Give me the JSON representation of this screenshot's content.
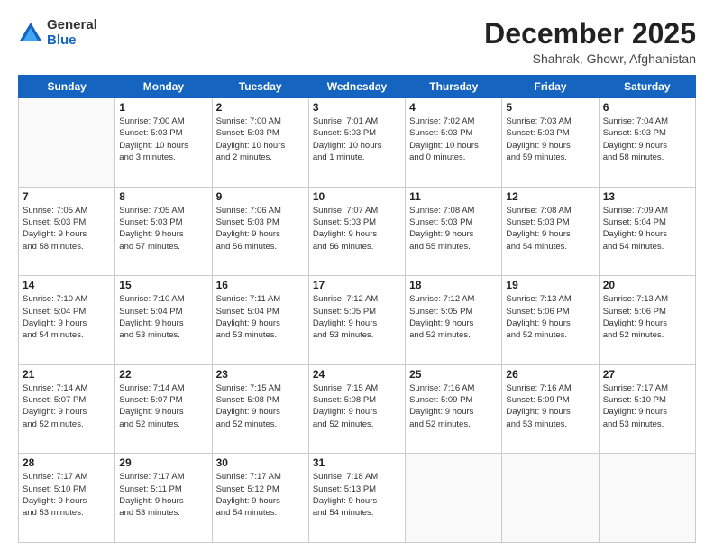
{
  "logo": {
    "general": "General",
    "blue": "Blue"
  },
  "header": {
    "month_year": "December 2025",
    "location": "Shahrak, Ghowr, Afghanistan"
  },
  "weekdays": [
    "Sunday",
    "Monday",
    "Tuesday",
    "Wednesday",
    "Thursday",
    "Friday",
    "Saturday"
  ],
  "weeks": [
    [
      {
        "day": "",
        "info": ""
      },
      {
        "day": "1",
        "info": "Sunrise: 7:00 AM\nSunset: 5:03 PM\nDaylight: 10 hours\nand 3 minutes."
      },
      {
        "day": "2",
        "info": "Sunrise: 7:00 AM\nSunset: 5:03 PM\nDaylight: 10 hours\nand 2 minutes."
      },
      {
        "day": "3",
        "info": "Sunrise: 7:01 AM\nSunset: 5:03 PM\nDaylight: 10 hours\nand 1 minute."
      },
      {
        "day": "4",
        "info": "Sunrise: 7:02 AM\nSunset: 5:03 PM\nDaylight: 10 hours\nand 0 minutes."
      },
      {
        "day": "5",
        "info": "Sunrise: 7:03 AM\nSunset: 5:03 PM\nDaylight: 9 hours\nand 59 minutes."
      },
      {
        "day": "6",
        "info": "Sunrise: 7:04 AM\nSunset: 5:03 PM\nDaylight: 9 hours\nand 58 minutes."
      }
    ],
    [
      {
        "day": "7",
        "info": "Sunrise: 7:05 AM\nSunset: 5:03 PM\nDaylight: 9 hours\nand 58 minutes."
      },
      {
        "day": "8",
        "info": "Sunrise: 7:05 AM\nSunset: 5:03 PM\nDaylight: 9 hours\nand 57 minutes."
      },
      {
        "day": "9",
        "info": "Sunrise: 7:06 AM\nSunset: 5:03 PM\nDaylight: 9 hours\nand 56 minutes."
      },
      {
        "day": "10",
        "info": "Sunrise: 7:07 AM\nSunset: 5:03 PM\nDaylight: 9 hours\nand 56 minutes."
      },
      {
        "day": "11",
        "info": "Sunrise: 7:08 AM\nSunset: 5:03 PM\nDaylight: 9 hours\nand 55 minutes."
      },
      {
        "day": "12",
        "info": "Sunrise: 7:08 AM\nSunset: 5:03 PM\nDaylight: 9 hours\nand 54 minutes."
      },
      {
        "day": "13",
        "info": "Sunrise: 7:09 AM\nSunset: 5:04 PM\nDaylight: 9 hours\nand 54 minutes."
      }
    ],
    [
      {
        "day": "14",
        "info": "Sunrise: 7:10 AM\nSunset: 5:04 PM\nDaylight: 9 hours\nand 54 minutes."
      },
      {
        "day": "15",
        "info": "Sunrise: 7:10 AM\nSunset: 5:04 PM\nDaylight: 9 hours\nand 53 minutes."
      },
      {
        "day": "16",
        "info": "Sunrise: 7:11 AM\nSunset: 5:04 PM\nDaylight: 9 hours\nand 53 minutes."
      },
      {
        "day": "17",
        "info": "Sunrise: 7:12 AM\nSunset: 5:05 PM\nDaylight: 9 hours\nand 53 minutes."
      },
      {
        "day": "18",
        "info": "Sunrise: 7:12 AM\nSunset: 5:05 PM\nDaylight: 9 hours\nand 52 minutes."
      },
      {
        "day": "19",
        "info": "Sunrise: 7:13 AM\nSunset: 5:06 PM\nDaylight: 9 hours\nand 52 minutes."
      },
      {
        "day": "20",
        "info": "Sunrise: 7:13 AM\nSunset: 5:06 PM\nDaylight: 9 hours\nand 52 minutes."
      }
    ],
    [
      {
        "day": "21",
        "info": "Sunrise: 7:14 AM\nSunset: 5:07 PM\nDaylight: 9 hours\nand 52 minutes."
      },
      {
        "day": "22",
        "info": "Sunrise: 7:14 AM\nSunset: 5:07 PM\nDaylight: 9 hours\nand 52 minutes."
      },
      {
        "day": "23",
        "info": "Sunrise: 7:15 AM\nSunset: 5:08 PM\nDaylight: 9 hours\nand 52 minutes."
      },
      {
        "day": "24",
        "info": "Sunrise: 7:15 AM\nSunset: 5:08 PM\nDaylight: 9 hours\nand 52 minutes."
      },
      {
        "day": "25",
        "info": "Sunrise: 7:16 AM\nSunset: 5:09 PM\nDaylight: 9 hours\nand 52 minutes."
      },
      {
        "day": "26",
        "info": "Sunrise: 7:16 AM\nSunset: 5:09 PM\nDaylight: 9 hours\nand 53 minutes."
      },
      {
        "day": "27",
        "info": "Sunrise: 7:17 AM\nSunset: 5:10 PM\nDaylight: 9 hours\nand 53 minutes."
      }
    ],
    [
      {
        "day": "28",
        "info": "Sunrise: 7:17 AM\nSunset: 5:10 PM\nDaylight: 9 hours\nand 53 minutes."
      },
      {
        "day": "29",
        "info": "Sunrise: 7:17 AM\nSunset: 5:11 PM\nDaylight: 9 hours\nand 53 minutes."
      },
      {
        "day": "30",
        "info": "Sunrise: 7:17 AM\nSunset: 5:12 PM\nDaylight: 9 hours\nand 54 minutes."
      },
      {
        "day": "31",
        "info": "Sunrise: 7:18 AM\nSunset: 5:13 PM\nDaylight: 9 hours\nand 54 minutes."
      },
      {
        "day": "",
        "info": ""
      },
      {
        "day": "",
        "info": ""
      },
      {
        "day": "",
        "info": ""
      }
    ]
  ]
}
